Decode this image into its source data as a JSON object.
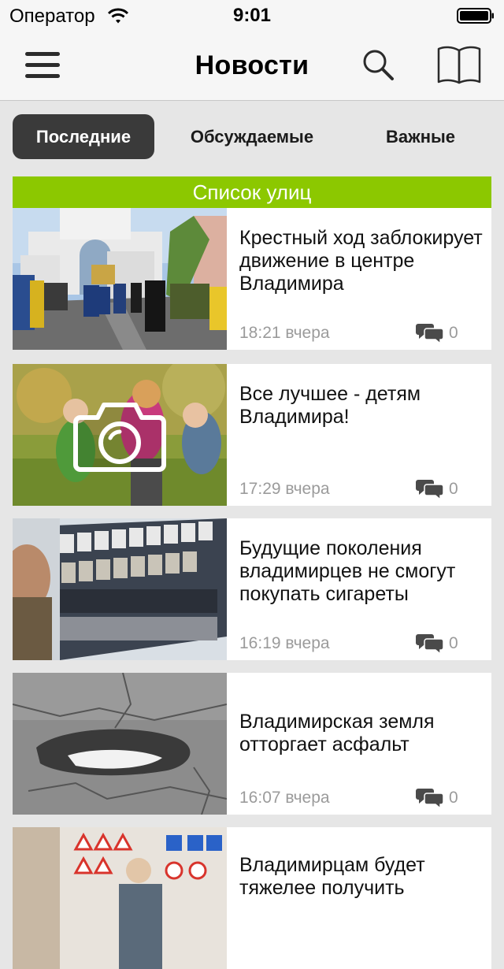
{
  "status_bar": {
    "carrier": "Оператор",
    "time": "9:01"
  },
  "nav": {
    "title": "Новости",
    "icons": [
      "menu-icon",
      "search-icon",
      "book-icon"
    ]
  },
  "tabs": [
    {
      "label": "Последние",
      "selected": true
    },
    {
      "label": "Обсуждаемые",
      "selected": false
    },
    {
      "label": "Важные",
      "selected": false
    }
  ],
  "banner": {
    "label": "Список улиц",
    "color": "#8cc800"
  },
  "news": [
    {
      "title": "Крестный ход заблокирует движение в центре Владимира",
      "time": "18:21 вчера",
      "comments": "0",
      "thumb": "procession-photo"
    },
    {
      "title": "Все лучшее - детям Владимира!",
      "time": "17:29 вчера",
      "comments": "0",
      "thumb": "children-photo",
      "badge": "camera-icon"
    },
    {
      "title": "Будущие поколения владимирцев не смогут покупать сигареты",
      "time": "16:19 вчера",
      "comments": "0",
      "thumb": "cigarettes-shelf-photo"
    },
    {
      "title": "Владимирская земля отторгает асфальт",
      "time": "16:07 вчера",
      "comments": "0",
      "thumb": "pothole-photo"
    },
    {
      "title": "Владимирцам будет тяжелее получить",
      "time": "",
      "comments": "",
      "thumb": "traffic-signs-photo"
    }
  ]
}
